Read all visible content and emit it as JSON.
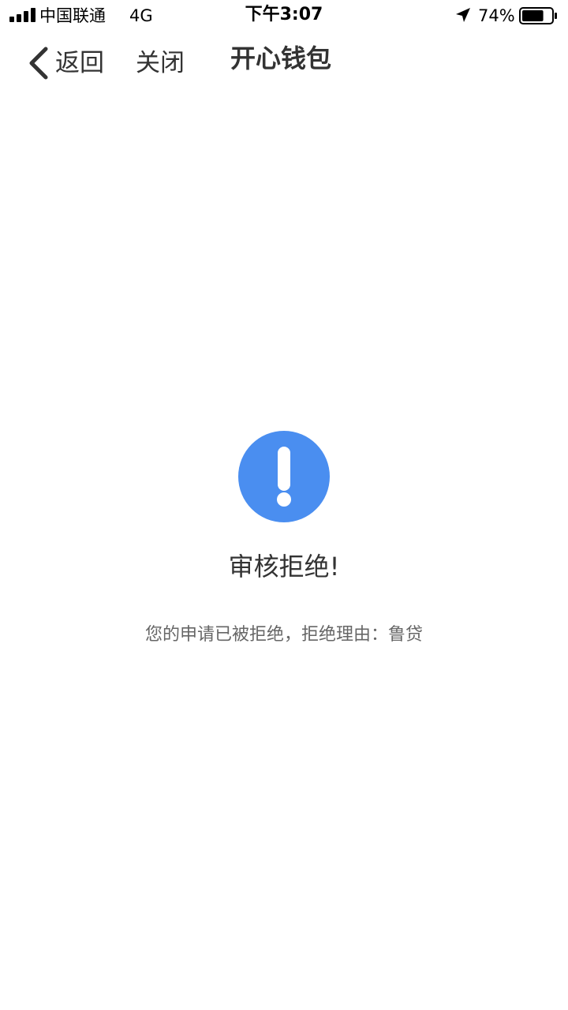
{
  "status_bar": {
    "carrier": "中国联通",
    "network": "4G",
    "time": "下午3:07",
    "battery_percent": "74%",
    "battery_level": 0.74,
    "icons": [
      "signal-icon",
      "location-arrow-icon",
      "battery-icon"
    ]
  },
  "nav": {
    "back_label": "返回",
    "close_label": "关闭",
    "title": "开心钱包",
    "icons": [
      "chevron-left-icon"
    ]
  },
  "result": {
    "icon": "exclamation-circle-icon",
    "accent_color": "#4a8ef0",
    "title": "审核拒绝!",
    "message": "您的申请已被拒绝，拒绝理由：鲁贷"
  }
}
